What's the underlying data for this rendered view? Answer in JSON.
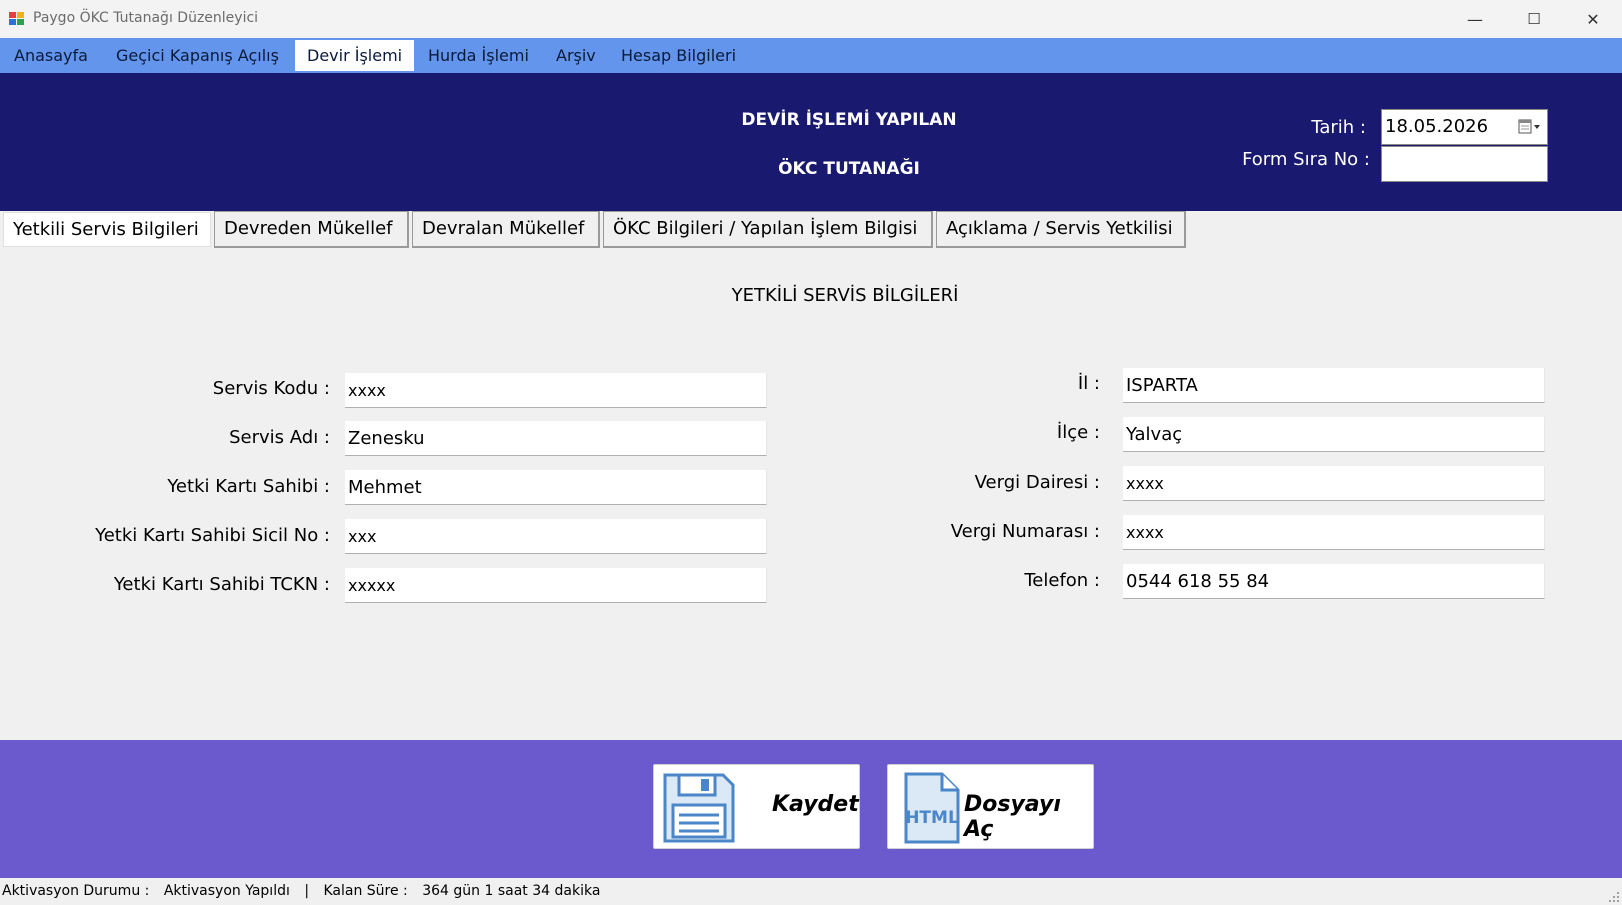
{
  "window": {
    "title": "Paygo ÖKC Tutanağı Düzenleyici",
    "minimize_glyph": "—",
    "maximize_glyph": "☐",
    "close_glyph": "✕"
  },
  "menu": {
    "items": [
      "Anasayfa",
      "Geçici Kapanış Açılış",
      "Devir İşlemi",
      "Hurda İşlemi",
      "Arşiv",
      "Hesap Bilgileri"
    ],
    "active": "Devir İşlemi"
  },
  "header": {
    "title_line1": "DEVİR İŞLEMİ YAPILAN",
    "title_line2": "ÖKC TUTANAĞI",
    "date_label": "Tarih :",
    "date_value": "18.05.2026",
    "form_no_label": "Form Sıra No :",
    "form_no_value": ""
  },
  "tabs": {
    "items": [
      "Yetkili Servis Bilgileri",
      "Devreden Mükellef",
      "Devralan Mükellef",
      "ÖKC Bilgileri / Yapılan İşlem Bilgisi",
      "Açıklama / Servis Yetkilisi"
    ],
    "active": "Yetkili Servis Bilgileri"
  },
  "section_title": "YETKİLİ SERVİS BİLGİLERİ",
  "form_left": [
    {
      "label": "Servis Kodu :",
      "value": "xxxx"
    },
    {
      "label": "Servis Adı :",
      "value": "Zenesku"
    },
    {
      "label": "Yetki Kartı Sahibi :",
      "value": "Mehmet"
    },
    {
      "label": "Yetki Kartı Sahibi Sicil No :",
      "value": "xxx"
    },
    {
      "label": "Yetki Kartı Sahibi TCKN :",
      "value": "xxxxx"
    }
  ],
  "form_right": [
    {
      "label": "İl :",
      "value": "ISPARTA"
    },
    {
      "label": "İlçe  :",
      "value": "Yalvaç"
    },
    {
      "label": "Vergi Dairesi :",
      "value": "xxxx"
    },
    {
      "label": "Vergi Numarası :",
      "value": "xxxx"
    },
    {
      "label": "Telefon :",
      "value": "0544 618 55 84"
    }
  ],
  "buttons": {
    "save_label": "Kaydet",
    "open_label": "Dosyayı Aç",
    "html_icon_text": "HTML"
  },
  "status": {
    "activation_label": "Aktivasyon Durumu :",
    "activation_value": "Aktivasyon Yapıldı",
    "separator": "|",
    "remaining_label": "Kalan Süre :",
    "remaining_value": "364 gün 1 saat 34 dakika"
  },
  "colors": {
    "menubar": "#6495ed",
    "header": "#191970",
    "footer": "#6a5acd",
    "icon_blue": "#4a86c8"
  },
  "icons": [
    "app-icon",
    "calendar-icon",
    "floppy-disk-icon",
    "html-file-icon",
    "resize-grip-icon"
  ]
}
